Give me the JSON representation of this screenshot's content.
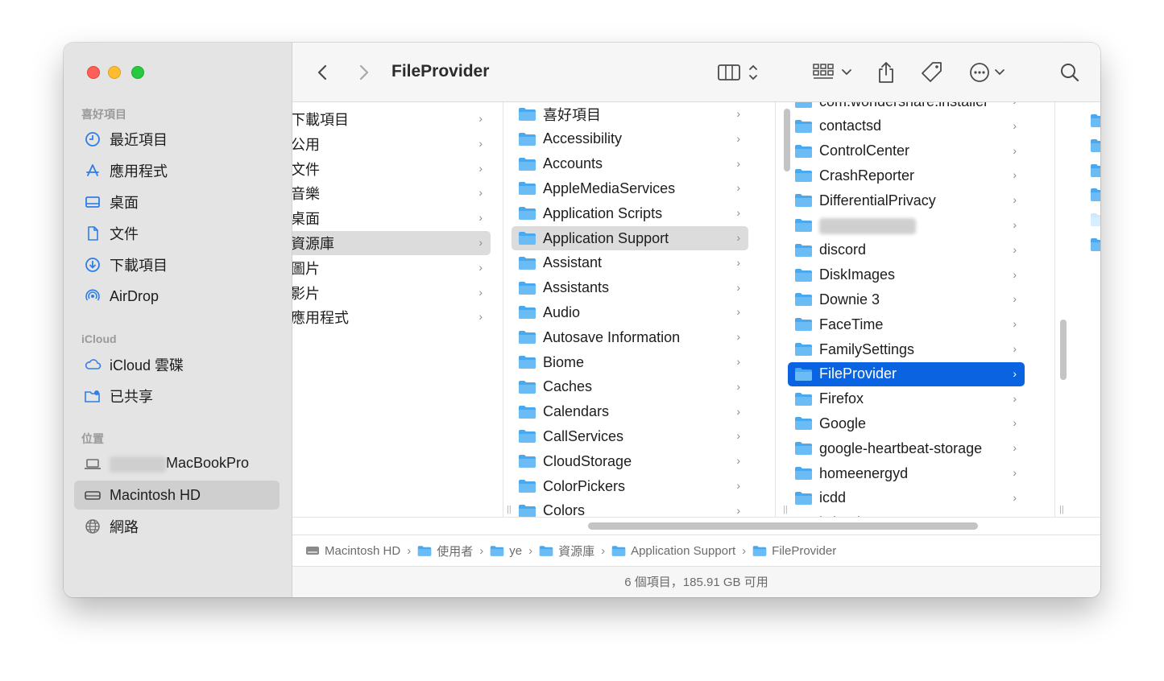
{
  "window": {
    "title": "FileProvider"
  },
  "sidebar": {
    "sections": [
      {
        "label": "喜好項目"
      },
      {
        "label": "iCloud"
      },
      {
        "label": "位置"
      }
    ],
    "favorites": [
      {
        "label": "最近項目",
        "icon": "clock-icon"
      },
      {
        "label": "應用程式",
        "icon": "applications-icon"
      },
      {
        "label": "桌面",
        "icon": "desktop-icon"
      },
      {
        "label": "文件",
        "icon": "document-icon"
      },
      {
        "label": "下載項目",
        "icon": "download-icon"
      },
      {
        "label": "AirDrop",
        "icon": "airdrop-icon"
      }
    ],
    "icloud": [
      {
        "label": "iCloud 雲碟",
        "icon": "cloud-icon"
      },
      {
        "label": "已共享",
        "icon": "shared-folder-icon"
      }
    ],
    "locations": [
      {
        "label": "MacBookPro",
        "icon": "laptop-icon"
      },
      {
        "label": "Macintosh HD",
        "icon": "disk-icon",
        "selected": true
      },
      {
        "label": "網路",
        "icon": "network-icon"
      }
    ]
  },
  "columns": [
    {
      "items": [
        "下載項目",
        "公用",
        "文件",
        "音樂",
        "桌面",
        "資源庫",
        "圖片",
        "影片",
        "應用程式"
      ],
      "selected_index": 5
    },
    {
      "items": [
        "喜好項目",
        "Accessibility",
        "Accounts",
        "AppleMediaServices",
        "Application Scripts",
        "Application Support",
        "Assistant",
        "Assistants",
        "Audio",
        "Autosave Information",
        "Biome",
        "Caches",
        "Calendars",
        "CallServices",
        "CloudStorage",
        "ColorPickers",
        "Colors"
      ],
      "selected_index": 5
    },
    {
      "items": [
        "com.wondershare.installer",
        "contactsd",
        "ControlCenter",
        "CrashReporter",
        "DifferentialPrivacy",
        "",
        "discord",
        "DiskImages",
        "Downie 3",
        "FaceTime",
        "FamilySettings",
        "FileProvider",
        "Firefox",
        "Google",
        "google-heartbeat-storage",
        "homeenergyd",
        "icdd",
        "iCloud"
      ],
      "selected_index": 11
    }
  ],
  "pathbar": [
    {
      "label": "Macintosh HD",
      "icon": "disk-icon"
    },
    {
      "label": "使用者",
      "icon": "folder-icon"
    },
    {
      "label": "ye",
      "icon": "home-folder-icon"
    },
    {
      "label": "資源庫",
      "icon": "folder-icon"
    },
    {
      "label": "Application Support",
      "icon": "folder-icon"
    },
    {
      "label": "FileProvider",
      "icon": "folder-icon"
    }
  ],
  "status": {
    "text": "6 個項目，185.91 GB 可用"
  },
  "colors": {
    "selection_blue": "#0a63e0",
    "folder_blue": "#4aa8ee"
  }
}
